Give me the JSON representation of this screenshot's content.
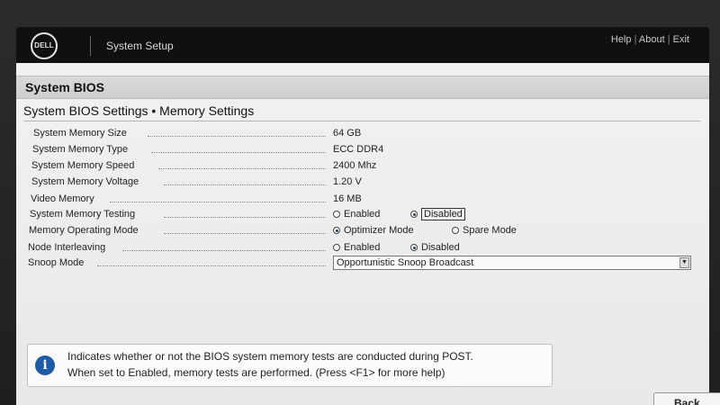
{
  "header": {
    "logo_text": "DELL",
    "app_title": "System Setup",
    "links": {
      "help": "Help",
      "about": "About",
      "exit": "Exit",
      "separator": "|"
    }
  },
  "section": {
    "title": "System BIOS"
  },
  "subsection": {
    "title": "System BIOS Settings • Memory Settings"
  },
  "settings": {
    "memory_size": {
      "label": "System Memory Size",
      "value": "64 GB"
    },
    "memory_type": {
      "label": "System Memory Type",
      "value": "ECC DDR4"
    },
    "memory_speed": {
      "label": "System Memory Speed",
      "value": "2400 Mhz"
    },
    "memory_voltage": {
      "label": "System Memory Voltage",
      "value": "1.20 V"
    },
    "video_memory": {
      "label": "Video Memory",
      "value": "16 MB"
    },
    "memory_testing": {
      "label": "System Memory Testing",
      "options": [
        "Enabled",
        "Disabled"
      ],
      "selected": "Disabled"
    },
    "operating_mode": {
      "label": "Memory Operating Mode",
      "options": [
        "Optimizer Mode",
        "Spare Mode"
      ],
      "selected": "Optimizer Mode"
    },
    "node_interleaving": {
      "label": "Node Interleaving",
      "options": [
        "Enabled",
        "Disabled"
      ],
      "selected": "Disabled"
    },
    "snoop_mode": {
      "label": "Snoop Mode",
      "value": "Opportunistic Snoop Broadcast"
    }
  },
  "help": {
    "icon": "info-icon",
    "line1": "Indicates whether or not the BIOS system memory tests are conducted during POST.",
    "line2": "When set to Enabled, memory tests are performed. (Press <F1> for more help)"
  },
  "footer": {
    "back_label": "Back"
  },
  "colors": {
    "header_bg": "#101010",
    "panel_bg": "#f1f1f1",
    "info_blue": "#1f5aa6",
    "radio_fill": "#1d3f7a"
  }
}
